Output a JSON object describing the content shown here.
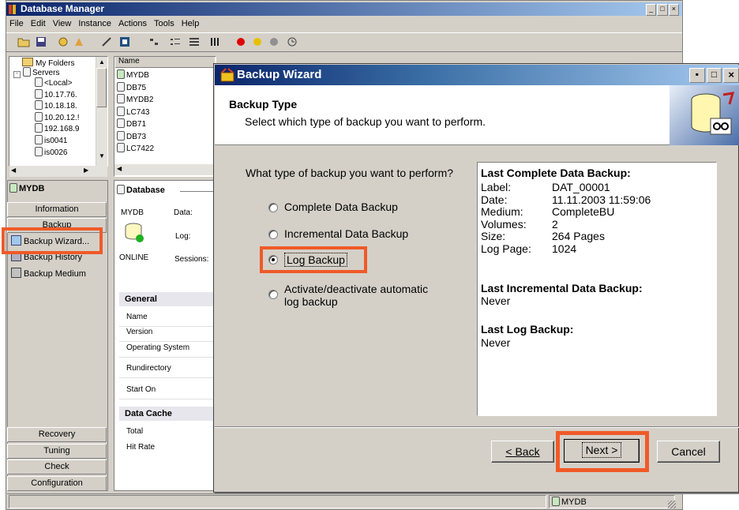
{
  "main_window": {
    "title": "Database Manager",
    "menu": [
      "File",
      "Edit",
      "View",
      "Instance",
      "Actions",
      "Tools",
      "Help"
    ],
    "tree": {
      "my_folders": "My Folders",
      "servers": "Servers",
      "nodes": [
        "<Local>",
        "10.17.76.",
        "10.18.18.",
        "10.20.12.!",
        "192.168.9",
        "is0041",
        "is0026"
      ]
    },
    "list": {
      "header": "Name",
      "items": [
        "MYDB",
        "DB75",
        "MYDB2",
        "LC743",
        "DB71",
        "DB73",
        "LC7422"
      ]
    },
    "db_panel": {
      "title": "MYDB",
      "nav_top": [
        "Information",
        "Backup"
      ],
      "actions": [
        "Backup Wizard...",
        "Backup History",
        "Backup Medium"
      ],
      "nav_bottom": [
        "Recovery",
        "Tuning",
        "Check",
        "Configuration"
      ]
    },
    "database_panel": {
      "title": "Database",
      "db_name": "MYDB",
      "data_label": "Data:",
      "log_label": "Log:",
      "status": "ONLINE",
      "sessions_label": "Sessions:",
      "general_header": "General",
      "general_rows": [
        "Name",
        "Version",
        "Operating System",
        "Rundirectory",
        "Start On"
      ],
      "cache_header": "Data Cache",
      "cache_rows": [
        "Total",
        "Hit Rate"
      ]
    },
    "status_bar": {
      "db": "MYDB"
    }
  },
  "wizard": {
    "title": "Backup Wizard",
    "heading": "Backup Type",
    "subheading": "Select which type of backup you want to perform.",
    "question": "What type of backup you want to perform?",
    "options": [
      {
        "label": "Complete Data Backup",
        "selected": false
      },
      {
        "label": "Incremental  Data Backup",
        "selected": false
      },
      {
        "label": "Log Backup",
        "selected": true
      },
      {
        "label_line1": "Activate/deactivate automatic",
        "label_line2": "log backup",
        "selected": false
      }
    ],
    "info": {
      "complete_title": "Last Complete Data Backup:",
      "rows": [
        {
          "k": "Label:",
          "v": "DAT_00001"
        },
        {
          "k": "Date:",
          "v": "11.11.2003 11:59:06"
        },
        {
          "k": "Medium:",
          "v": "CompleteBU"
        },
        {
          "k": "Volumes:",
          "v": "2"
        },
        {
          "k": "Size:",
          "v": "264 Pages"
        },
        {
          "k": "Log Page:",
          "v": "1024"
        }
      ],
      "incremental_title": "Last Incremental Data Backup:",
      "incremental_value": "Never",
      "log_title": "Last Log Backup:",
      "log_value": "Never"
    },
    "buttons": {
      "back": "< Back",
      "next": "Next >",
      "cancel": "Cancel"
    }
  },
  "colors": {
    "highlight": "#f05a28",
    "titlebar": "#0a246a",
    "face": "#d4d0c8"
  }
}
